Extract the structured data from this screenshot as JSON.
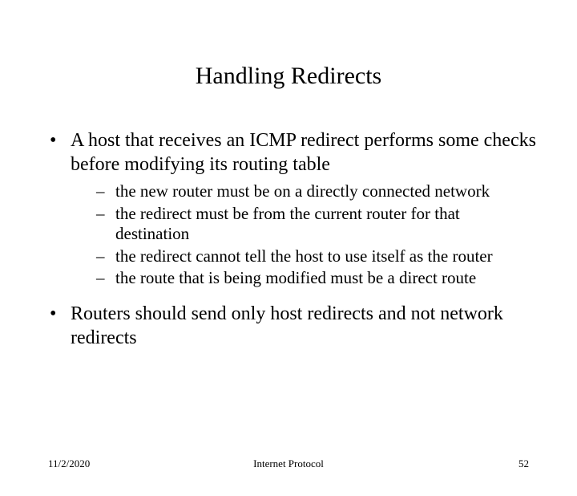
{
  "title": "Handling Redirects",
  "bullets": [
    {
      "text": "A host that receives an ICMP redirect performs some checks before modifying its routing table",
      "sub": [
        "the new router must be on a directly connected network",
        "the redirect must be from the current router for that destination",
        "the redirect cannot tell the host to use itself as the router",
        "the route that is being modified must be a direct route"
      ]
    },
    {
      "text": "Routers should send only host redirects and not network redirects",
      "sub": []
    }
  ],
  "footer": {
    "date": "11/2/2020",
    "subject": "Internet Protocol",
    "page": "52"
  },
  "glyphs": {
    "bullet": "•",
    "dash": "–"
  }
}
